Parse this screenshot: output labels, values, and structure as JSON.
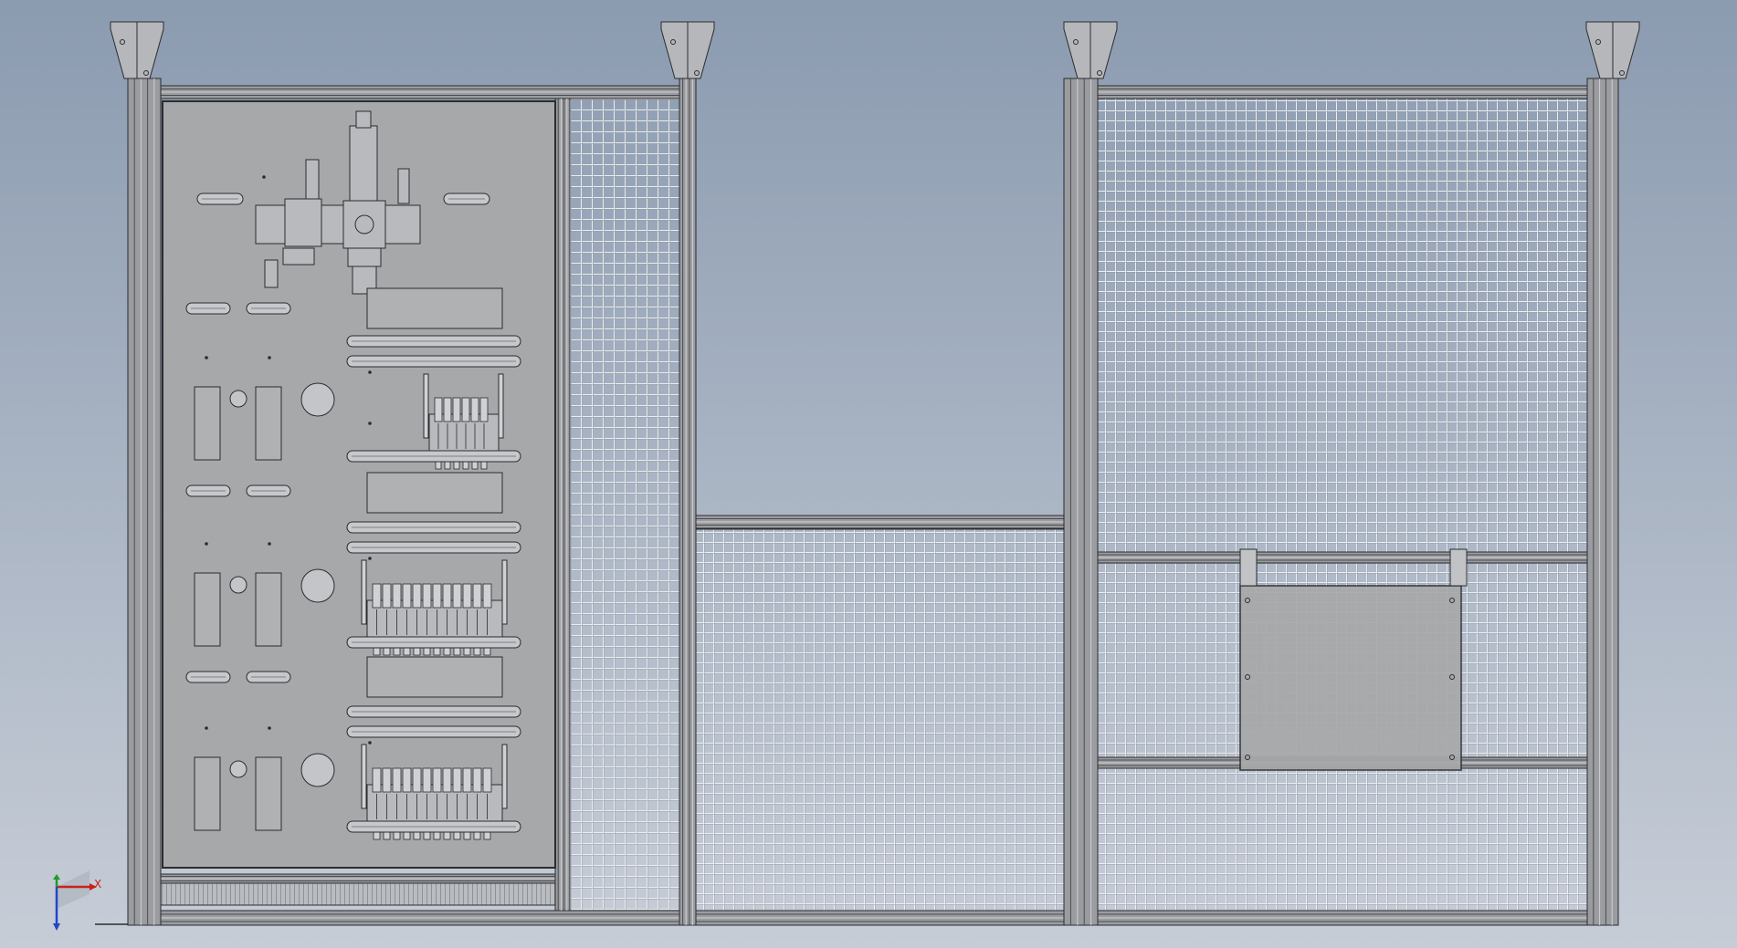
{
  "viewport": {
    "background_top": "#8b9bb0",
    "background_bottom": "#c7cdd7"
  },
  "colors": {
    "frame": "#9a9ca0",
    "frame_dark": "#4a4c50",
    "panel": "#a7a8a9",
    "mesh": "#dfe3e8",
    "outline": "#2a2c30",
    "component": "#b8babd",
    "axis_x": "#c8201c",
    "axis_y": "#1f9a2b",
    "axis_z": "#2246c6"
  },
  "icons": {
    "triad": "coordinate-triad-icon"
  },
  "triad": {
    "x_label": "X"
  }
}
